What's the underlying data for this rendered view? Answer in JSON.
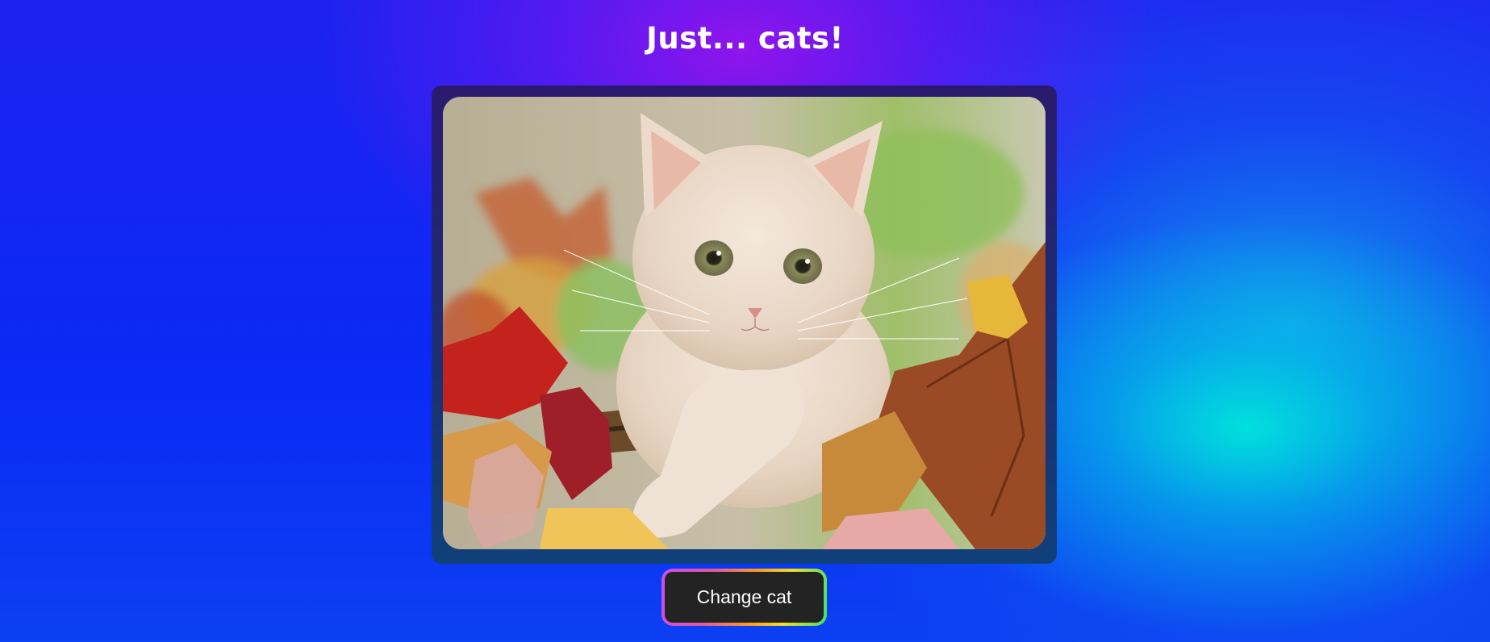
{
  "page": {
    "title": "Just... cats!"
  },
  "photo": {
    "alt": "cat",
    "subject": "cream kitten among autumn leaves"
  },
  "actions": {
    "change_label": "Change cat"
  },
  "colors": {
    "button_bg": "#232323",
    "frame_top": "#2a1a6e",
    "frame_bottom": "#10407a",
    "title_text": "#ffffff"
  }
}
